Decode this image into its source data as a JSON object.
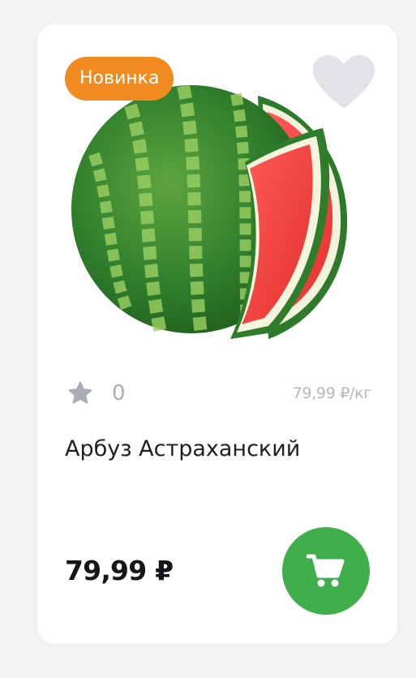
{
  "product": {
    "badge": "Новинка",
    "rating_count": "0",
    "unit_price": "79,99 ₽/кг",
    "name": "Арбуз Астраханский",
    "price": "79,99 ₽"
  },
  "icons": {
    "favorite": "heart-icon",
    "rating": "star-icon",
    "cart": "shopping-cart-icon",
    "image": "watermelon"
  },
  "colors": {
    "badge": "#f28b1f",
    "cart_button": "#3fae4b",
    "heart": "#e2e3e6",
    "star": "#a9adb7"
  }
}
